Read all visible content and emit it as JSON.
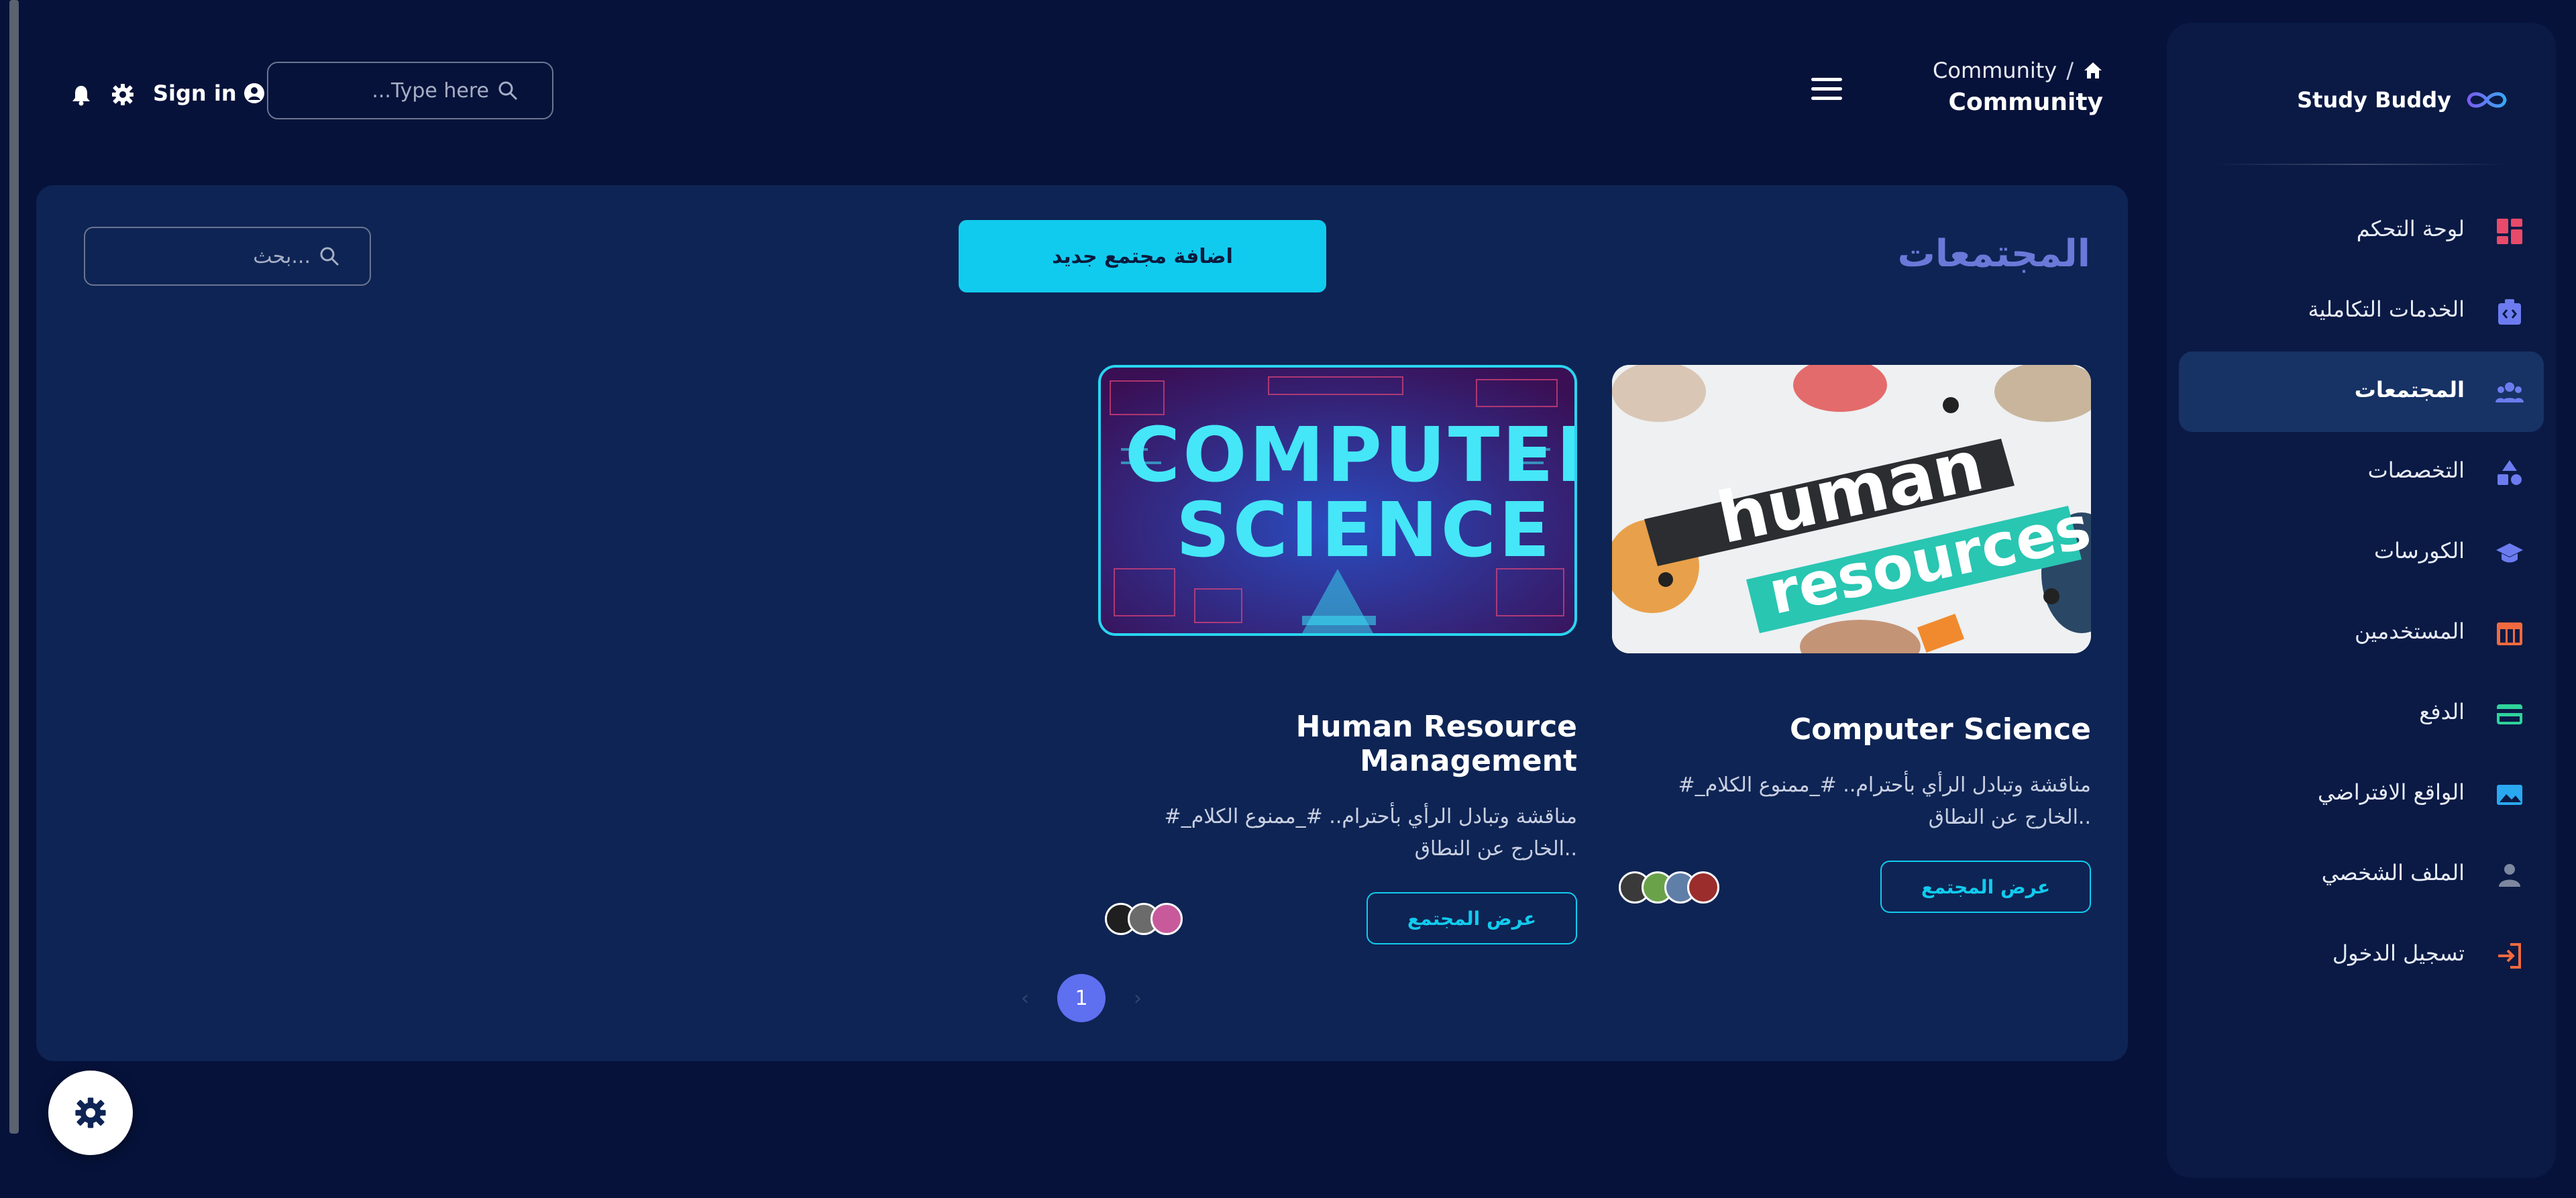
{
  "brand": {
    "name": "Study Buddy",
    "logo_icon": "infinity-icon",
    "accent": "#7b5cf0"
  },
  "sidebar": {
    "items": [
      {
        "label": "لوحة التحكم",
        "icon": "dashboard-icon",
        "color": "#e84a6a"
      },
      {
        "label": "الخدمات التكاملية",
        "icon": "integration-icon",
        "color": "#6c7cf0"
      },
      {
        "label": "المجتمعات",
        "icon": "community-icon",
        "color": "#6c7cf0",
        "active": true
      },
      {
        "label": "التخصصات",
        "icon": "shapes-icon",
        "color": "#6c7cf0"
      },
      {
        "label": "الكورسات",
        "icon": "graduation-cap-icon",
        "color": "#6c7cf0"
      },
      {
        "label": "المستخدمين",
        "icon": "table-icon",
        "color": "#f26a3e"
      },
      {
        "label": "الدفع",
        "icon": "credit-card-icon",
        "color": "#2fd39a"
      },
      {
        "label": "الواقع الافتراضي",
        "icon": "vr-icon",
        "color": "#2aa8f0"
      },
      {
        "label": "الملف الشخصي",
        "icon": "person-icon",
        "color": "#7d879f"
      },
      {
        "label": "تسجيل الدخول",
        "icon": "sign-in-icon",
        "color": "#f26a3e"
      }
    ]
  },
  "header": {
    "breadcrumb": "Community",
    "breadcrumb_sep": "/",
    "home_icon": "home-icon",
    "title": "Community",
    "search_placeholder": "...Type here",
    "signin_label": "Sign in"
  },
  "main": {
    "section_title": "المجتمعات",
    "add_button": "اضافة مجتمع جديد",
    "search_placeholder": "بحث...",
    "cards": [
      {
        "title": "Computer Science",
        "description": "#_مناقشة وتبادل الرأي بأحترام.. #_ممنوع الكلام الخارج عن النطاق..",
        "image_text": [
          "human",
          "resources."
        ],
        "button": "عرض المجتمع",
        "avatars": 4
      },
      {
        "title": "Human Resource Management",
        "description": "#_مناقشة وتبادل الرأي بأحترام.. #_ممنوع الكلام الخارج عن النطاق..",
        "image_text": [
          "COMPUTER",
          "SCIENCE"
        ],
        "button": "عرض المجتمع",
        "avatars": 3
      }
    ],
    "pagination": {
      "current": "1",
      "prev": "‹",
      "next": "›"
    }
  },
  "colors": {
    "accent_cyan": "#11cbee",
    "page_bg": "#06123a",
    "card_bg": "#0e2454",
    "title_purple": "#6a79d8"
  }
}
